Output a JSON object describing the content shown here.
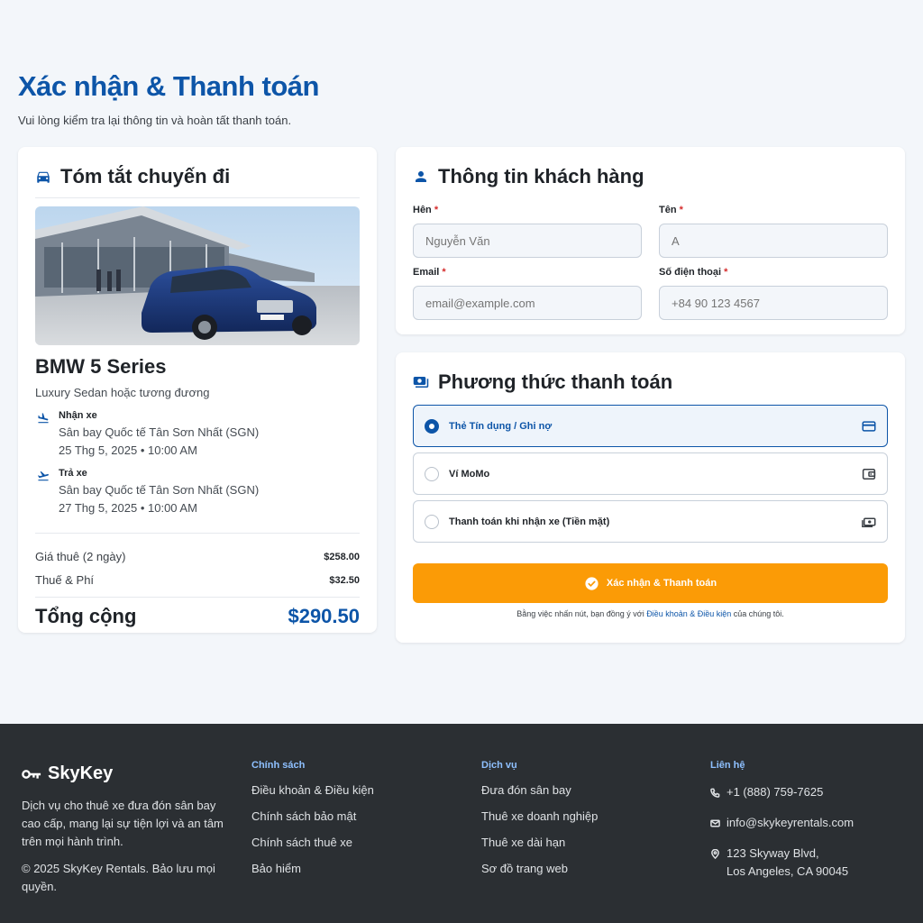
{
  "header": {
    "title": "Xác nhận & Thanh toán",
    "subtitle": "Vui lòng kiểm tra lại thông tin và hoàn tất thanh toán."
  },
  "summary": {
    "title": "Tóm tắt chuyến đi",
    "car_name": "BMW 5 Series",
    "car_class": "Luxury Sedan hoặc tương đương",
    "pickup": {
      "label": "Nhận xe",
      "location": "Sân bay Quốc tế Tân Sơn Nhất (SGN)",
      "datetime": "25 Thg 5, 2025 • 10:00 AM"
    },
    "dropoff": {
      "label": "Trả xe",
      "location": "Sân bay Quốc tế Tân Sơn Nhất (SGN)",
      "datetime": "27 Thg 5, 2025 • 10:00 AM"
    },
    "rental_label": "Giá thuê (2 ngày)",
    "rental_value": "$258.00",
    "fees_label": "Thuế & Phí",
    "fees_value": "$32.50",
    "total_label": "Tổng cộng",
    "total_value": "$290.50"
  },
  "customer": {
    "title": "Thông tin khách hàng",
    "last_name_label": "Hên",
    "last_name_placeholder": "Nguyễn Văn",
    "first_name_label": "Tên",
    "first_name_placeholder": "A",
    "email_label": "Email",
    "email_placeholder": "email@example.com",
    "phone_label": "Số điện thoại",
    "phone_placeholder": "+84 90 123 4567",
    "required_mark": "*"
  },
  "payment": {
    "title": "Phương thức thanh toán",
    "options": [
      {
        "label": "Thẻ Tín dụng / Ghi nợ",
        "icon": "credit-card-icon",
        "selected": true
      },
      {
        "label": "Ví MoMo",
        "icon": "wallet-icon",
        "selected": false
      },
      {
        "label": "Thanh toán khi nhận xe (Tiền mặt)",
        "icon": "cash-icon",
        "selected": false
      }
    ],
    "confirm_label": "Xác nhận & Thanh toán",
    "terms_prefix": "Bằng việc nhấn nút, bạn đồng ý với ",
    "terms_link": "Điều khoản & Điều kiện",
    "terms_suffix": " của chúng tôi."
  },
  "footer": {
    "brand": "SkyKey",
    "description": "Dịch vụ cho thuê xe đưa đón sân bay cao cấp, mang lại sự tiện lợi và an tâm trên mọi hành trình.",
    "copyright": "© 2025 SkyKey Rentals. Bảo lưu mọi quyền.",
    "policy_heading": "Chính sách",
    "policy_links": [
      "Điều khoản & Điều kiện",
      "Chính sách bảo mật",
      "Chính sách thuê xe",
      "Bảo hiểm"
    ],
    "services_heading": "Dịch vụ",
    "services_links": [
      "Đưa đón sân bay",
      "Thuê xe doanh nghiệp",
      "Thuê xe dài hạn",
      "Sơ đồ trang web"
    ],
    "contact_heading": "Liên hệ",
    "phone": "+1 (888) 759-7625",
    "email": "info@skykeyrentals.com",
    "address_line1": "123 Skyway Blvd,",
    "address_line2": "Los Angeles, CA 90045"
  },
  "colors": {
    "primary": "#0d55a8",
    "accent": "#fb9b06",
    "footer_bg": "#2b2f33"
  }
}
